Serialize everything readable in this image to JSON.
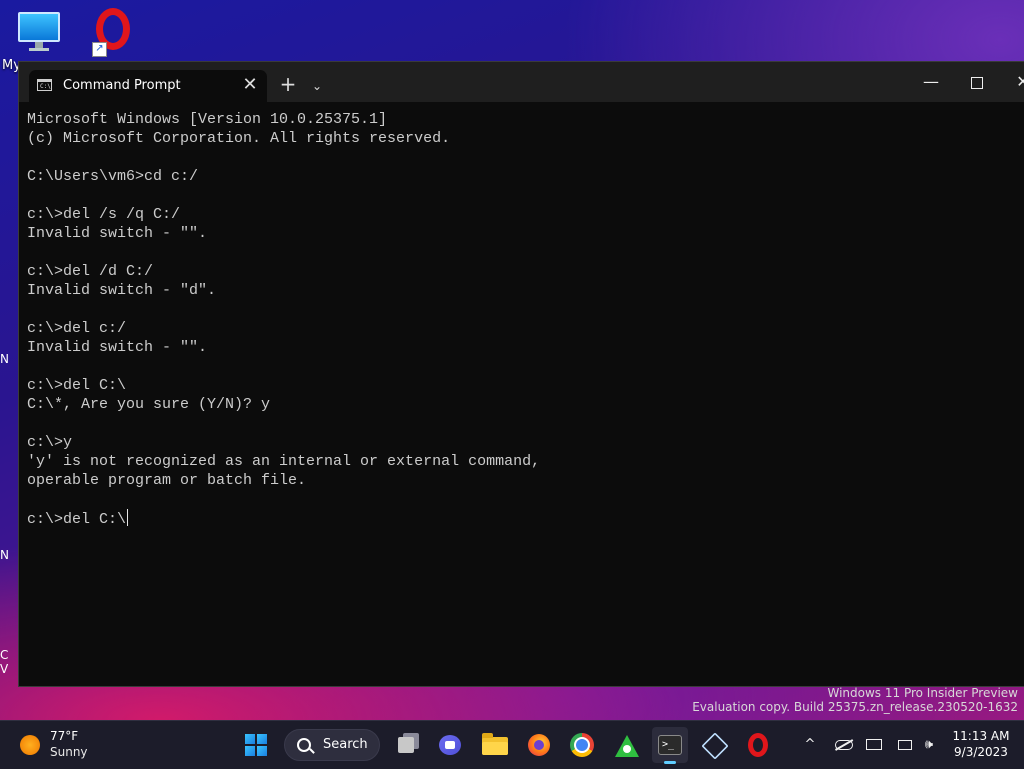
{
  "desktop": {
    "this_pc_label_partial": "My",
    "left_edge_letters": [
      "N",
      "N",
      "C",
      "V"
    ]
  },
  "window": {
    "tab_title": "Command Prompt",
    "tab_close_glyph": "✕",
    "new_tab_glyph": "+",
    "dropdown_glyph": "⌄",
    "minimize_glyph": "—",
    "close_glyph": "✕",
    "console_lines": [
      "Microsoft Windows [Version 10.0.25375.1]",
      "(c) Microsoft Corporation. All rights reserved.",
      "",
      "C:\\Users\\vm6>cd c:/",
      "",
      "c:\\>del /s /q C:/",
      "Invalid switch - \"\".",
      "",
      "c:\\>del /d C:/",
      "Invalid switch - \"d\".",
      "",
      "c:\\>del c:/",
      "Invalid switch - \"\".",
      "",
      "c:\\>del C:\\",
      "C:\\*, Are you sure (Y/N)? y",
      "",
      "c:\\>y",
      "'y' is not recognized as an internal or external command,",
      "operable program or batch file.",
      "",
      "c:\\>del C:\\"
    ]
  },
  "watermark": {
    "line1": "Windows 11 Pro Insider Preview",
    "line2": "Evaluation copy. Build 25375.zn_release.230520-1632"
  },
  "taskbar": {
    "weather": {
      "temp": "77°F",
      "condition": "Sunny"
    },
    "search_label": "Search",
    "apps": [
      "start-icon",
      "search-icon",
      "task-view-icon",
      "meet-icon",
      "file-explorer-icon",
      "firefox-icon",
      "chrome-icon",
      "green-app-icon",
      "terminal-icon",
      "virtualbox-icon",
      "opera-icon"
    ],
    "active_app": "terminal",
    "tray": {
      "chevron_glyph": "^"
    },
    "clock": {
      "time": "11:13 AM",
      "date": "9/3/2023"
    }
  },
  "colors": {
    "console_bg": "#0c0c0c",
    "console_fg": "#cccccc",
    "accent": "#60cdff",
    "opera_red": "#e0161b"
  }
}
